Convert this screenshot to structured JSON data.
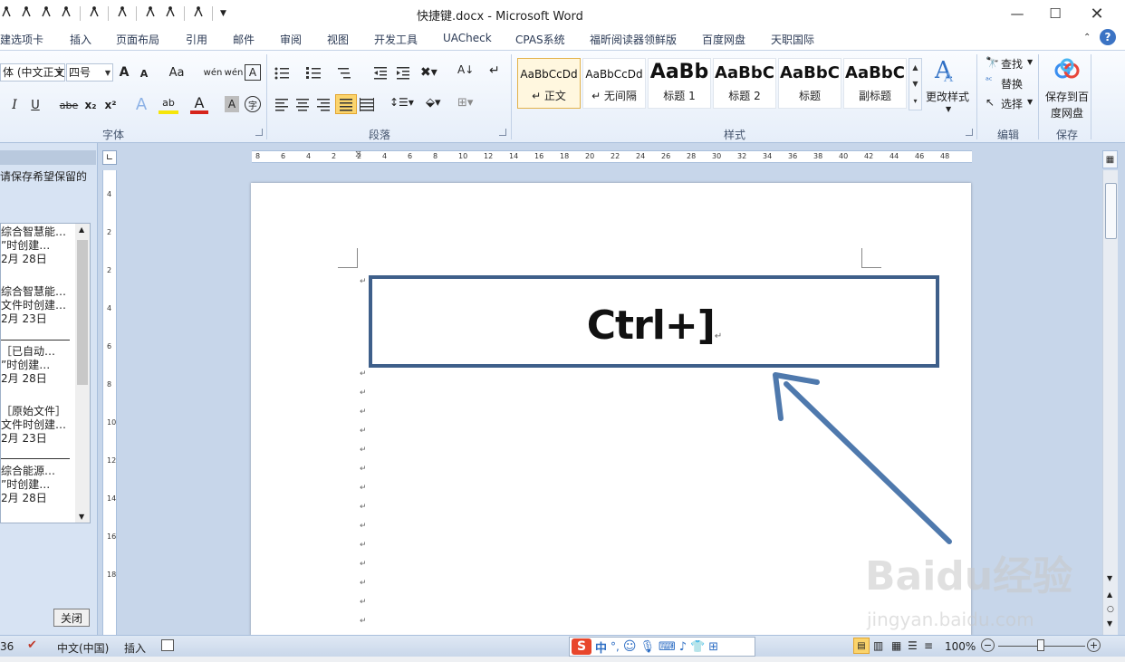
{
  "window": {
    "title": "快捷键.docx - Microsoft Word"
  },
  "tabs": [
    "建选项卡",
    "插入",
    "页面布局",
    "引用",
    "邮件",
    "审阅",
    "视图",
    "开发工具",
    "UACheck",
    "CPAS系统",
    "福昕阅读器领鲜版",
    "百度网盘",
    "天职国际"
  ],
  "font_group": {
    "font_name": "体 (中文正文)",
    "font_size": "四号",
    "label": "字体",
    "buttons": {
      "grow": "A",
      "shrink": "A",
      "case": "Aa",
      "italic": "I",
      "underline": "U",
      "strike": "abe",
      "subscript": "x₂",
      "superscript": "x²",
      "pinyin_top": "wén",
      "border_char": "A",
      "highlight": "ab",
      "font_color": "A",
      "shade_char": "A",
      "enclose": "字"
    }
  },
  "paragraph_group": {
    "label": "段落"
  },
  "styles_group": {
    "label": "样式",
    "styles": [
      {
        "sample": "AaBbCcDd",
        "name": "↵ 正文"
      },
      {
        "sample": "AaBbCcDd",
        "name": "↵ 无间隔"
      },
      {
        "sample": "AaBb",
        "name": "标题 1"
      },
      {
        "sample": "AaBbC",
        "name": "标题 2"
      },
      {
        "sample": "AaBbC",
        "name": "标题"
      },
      {
        "sample": "AaBbC",
        "name": "副标题"
      }
    ],
    "change_styles": "更改样式"
  },
  "edit_group": {
    "label": "编辑",
    "find": "查找",
    "replace": "替换",
    "select": "选择"
  },
  "save_group": {
    "label": "保存",
    "save_line1": "保存到百",
    "save_line2": "度网盘"
  },
  "left_pane": {
    "message": "请保存希望保留的",
    "items": [
      {
        "line1": "综合智慧能…",
        "line2": "”时创建…",
        "line3": "2月 28日"
      },
      {
        "line1": "综合智慧能…",
        "line2": "文件时创建…",
        "line3": "2月 23日"
      },
      {
        "line1": "［已自动…",
        "line2": "”时创建…",
        "line3": "2月 28日"
      },
      {
        "line1": "［原始文件］",
        "line2": "文件时创建…",
        "line3": "2月 23日"
      },
      {
        "line1": "综合能源…",
        "line2": "”时创建…",
        "line3": "2月 28日"
      }
    ],
    "close_button": "关闭"
  },
  "ruler": {
    "h_numbers": [
      "8",
      "6",
      "4",
      "2",
      "2",
      "4",
      "6",
      "8",
      "10",
      "12",
      "14",
      "16",
      "18",
      "20",
      "22",
      "24",
      "26",
      "28",
      "30",
      "32",
      "34",
      "36",
      "38",
      "40",
      "42",
      "44",
      "46",
      "48"
    ],
    "v_numbers": [
      "4",
      "2",
      "2",
      "4",
      "6",
      "8",
      "10",
      "12",
      "14",
      "16",
      "18"
    ]
  },
  "document": {
    "callout_text": "Ctrl+]",
    "para_mark": "↵"
  },
  "status": {
    "page_num": "36",
    "language": "中文(中国)",
    "mode": "插入",
    "zoom": "100%"
  },
  "ime": {
    "cn": "中",
    "punct": "°,"
  },
  "watermark": {
    "brand": "Baidu经验",
    "url": "jingyan.baidu.com"
  },
  "colors": {
    "callout_border": "#3e5f8a",
    "arrow": "#4f79ad",
    "ribbon_bg": "#e6eef9",
    "accent_select": "#e3b24a"
  }
}
